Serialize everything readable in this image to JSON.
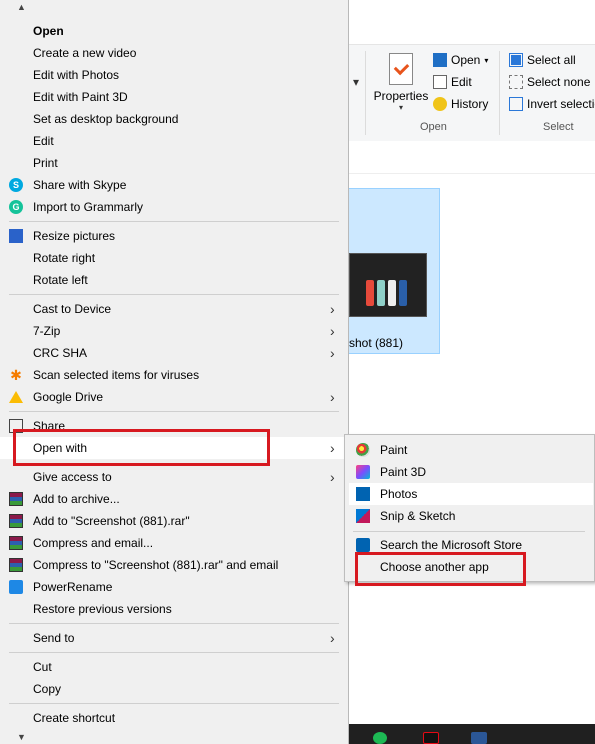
{
  "explorer": {
    "ribbon": {
      "properties_label": "Properties",
      "open_group": {
        "open": "Open",
        "edit": "Edit",
        "history": "History",
        "group_label": "Open"
      },
      "select_group": {
        "select_all": "Select all",
        "select_none": "Select none",
        "invert": "Invert selectio",
        "group_label": "Select"
      }
    },
    "file": {
      "name": "shot (881)"
    }
  },
  "context_menu": {
    "items": [
      {
        "label": "Open",
        "bold": true
      },
      {
        "label": "Create a new video"
      },
      {
        "label": "Edit with Photos"
      },
      {
        "label": "Edit with Paint 3D"
      },
      {
        "label": "Set as desktop background"
      },
      {
        "label": "Edit"
      },
      {
        "label": "Print"
      },
      {
        "label": "Share with Skype",
        "icon": "skype-icon"
      },
      {
        "label": "Import to Grammarly",
        "icon": "grammarly-icon"
      },
      {
        "label": "Resize pictures",
        "icon": "resize-pictures-icon"
      },
      {
        "label": "Rotate right"
      },
      {
        "label": "Rotate left"
      },
      {
        "label": "Cast to Device",
        "submenu": true
      },
      {
        "label": "7-Zip",
        "submenu": true
      },
      {
        "label": "CRC SHA",
        "submenu": true
      },
      {
        "label": "Scan selected items for viruses",
        "icon": "avast-icon"
      },
      {
        "label": "Google Drive",
        "icon": "google-drive-icon",
        "submenu": true
      },
      {
        "label": "Share",
        "icon": "share-icon"
      },
      {
        "label": "Open with",
        "submenu": true,
        "highlighted": true
      },
      {
        "label": "Give access to",
        "submenu": true
      },
      {
        "label": "Add to archive...",
        "icon": "winrar-icon"
      },
      {
        "label": "Add to \"Screenshot (881).rar\"",
        "icon": "winrar-icon"
      },
      {
        "label": "Compress and email...",
        "icon": "winrar-icon"
      },
      {
        "label": "Compress to \"Screenshot (881).rar\" and email",
        "icon": "winrar-icon"
      },
      {
        "label": "PowerRename",
        "icon": "powerrename-icon"
      },
      {
        "label": "Restore previous versions"
      },
      {
        "label": "Send to",
        "submenu": true
      },
      {
        "label": "Cut"
      },
      {
        "label": "Copy"
      },
      {
        "label": "Create shortcut"
      }
    ]
  },
  "open_with_menu": {
    "items": [
      {
        "label": "Paint",
        "icon": "paint-icon"
      },
      {
        "label": "Paint 3D",
        "icon": "paint-3d-icon"
      },
      {
        "label": "Photos",
        "icon": "photos-icon"
      },
      {
        "label": "Snip & Sketch",
        "icon": "snip-sketch-icon"
      },
      {
        "label": "Search the Microsoft Store",
        "icon": "microsoft-store-icon"
      },
      {
        "label": "Choose another app"
      }
    ]
  },
  "colors": {
    "highlight_border": "#d71920",
    "menu_bg": "#f0f0f0",
    "selected_tile": "#cce8ff"
  }
}
